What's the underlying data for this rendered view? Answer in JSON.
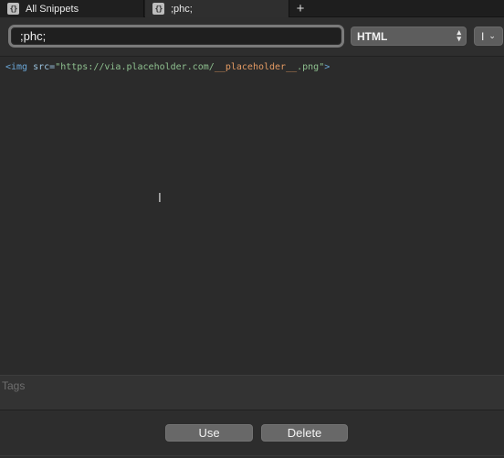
{
  "tabs": [
    {
      "label": "All Snippets",
      "icon": "braces-icon",
      "icon_glyph": "{}"
    },
    {
      "label": ";phc;",
      "icon": "braces-icon",
      "icon_glyph": "{}"
    }
  ],
  "new_tab_label": "+",
  "toolbar": {
    "snippet_title": ";phc;",
    "language": "HTML",
    "cursor_glyph": "I",
    "chevron_down": "⌄"
  },
  "editor": {
    "code_tokens": {
      "tag_open": "<img",
      "attr": " src=",
      "str_start": "\"https://via.placeholder.com/",
      "placeholder": "__placeholder__",
      "str_end": ".png\"",
      "tag_close": ">"
    },
    "ibeam_glyph": "I"
  },
  "tags": {
    "placeholder": "Tags"
  },
  "buttons": {
    "use": "Use",
    "delete": "Delete"
  }
}
